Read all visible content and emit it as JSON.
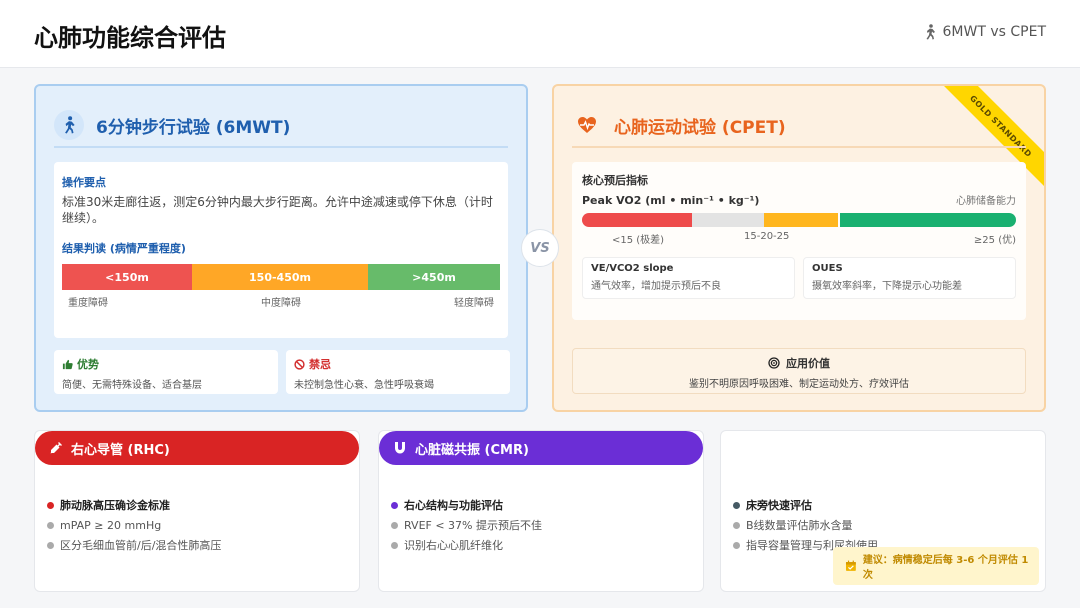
{
  "header": {
    "title": "心肺功能综合评估",
    "tag": "6MWT vs CPET"
  },
  "vs_label": "VS",
  "sixmwt": {
    "title": "6分钟步行试验 (6MWT)",
    "ops_title": "操作要点",
    "ops_desc": "标准30米走廊往返，测定6分钟内最大步行距离。允许中途减速或停下休息（计时继续）。",
    "result_title": "结果判读 (病情严重程度)",
    "segments": [
      "<150m",
      "150-450m",
      ">450m"
    ],
    "segment_labels": [
      "重度障碍",
      "中度障碍",
      "轻度障碍"
    ],
    "pros_title": "优势",
    "pros_desc": "简便、无需特殊设备、适合基层",
    "cons_title": "禁忌",
    "cons_desc": "未控制急性心衰、急性呼吸衰竭"
  },
  "cpet": {
    "title": "心肺运动试验 (CPET)",
    "ribbon": "GOLD STANDARD",
    "core_title": "核心预后指标",
    "peak_label": "Peak VO2 (ml • min⁻¹ • kg⁻¹)",
    "peak_right": "心肺储备能力",
    "scale_labels": [
      "<15 (极差)",
      "15-20-25",
      "≥25 (优)"
    ],
    "sub1_title": "VE/VCO2 slope",
    "sub1_desc": "通气效率，增加提示预后不良",
    "sub2_title": "OUES",
    "sub2_desc": "摄氧效率斜率，下降提示心功能差",
    "value_title": "应用价值",
    "value_desc": "鉴别不明原因呼吸困难、制定运动处方、疗效评估"
  },
  "rhc": {
    "title": "右心导管 (RHC)",
    "items": [
      "肺动脉高压确诊金标准",
      "mPAP ≥ 20 mmHg",
      "区分毛细血管前/后/混合性肺高压"
    ],
    "color": "#d92424"
  },
  "cmr": {
    "title": "心脏磁共振 (CMR)",
    "items": [
      "右心结构与功能评估",
      "RVEF < 37% 提示预后不佳",
      "识别右心心肌纤维化"
    ],
    "color": "#6b2ed6"
  },
  "bedside": {
    "items": [
      "床旁快速评估",
      "B线数量评估肺水含量",
      "指导容量管理与利尿剂使用"
    ],
    "suggestion": "建议：病情稳定后每 3-6 个月评估 1 次"
  }
}
